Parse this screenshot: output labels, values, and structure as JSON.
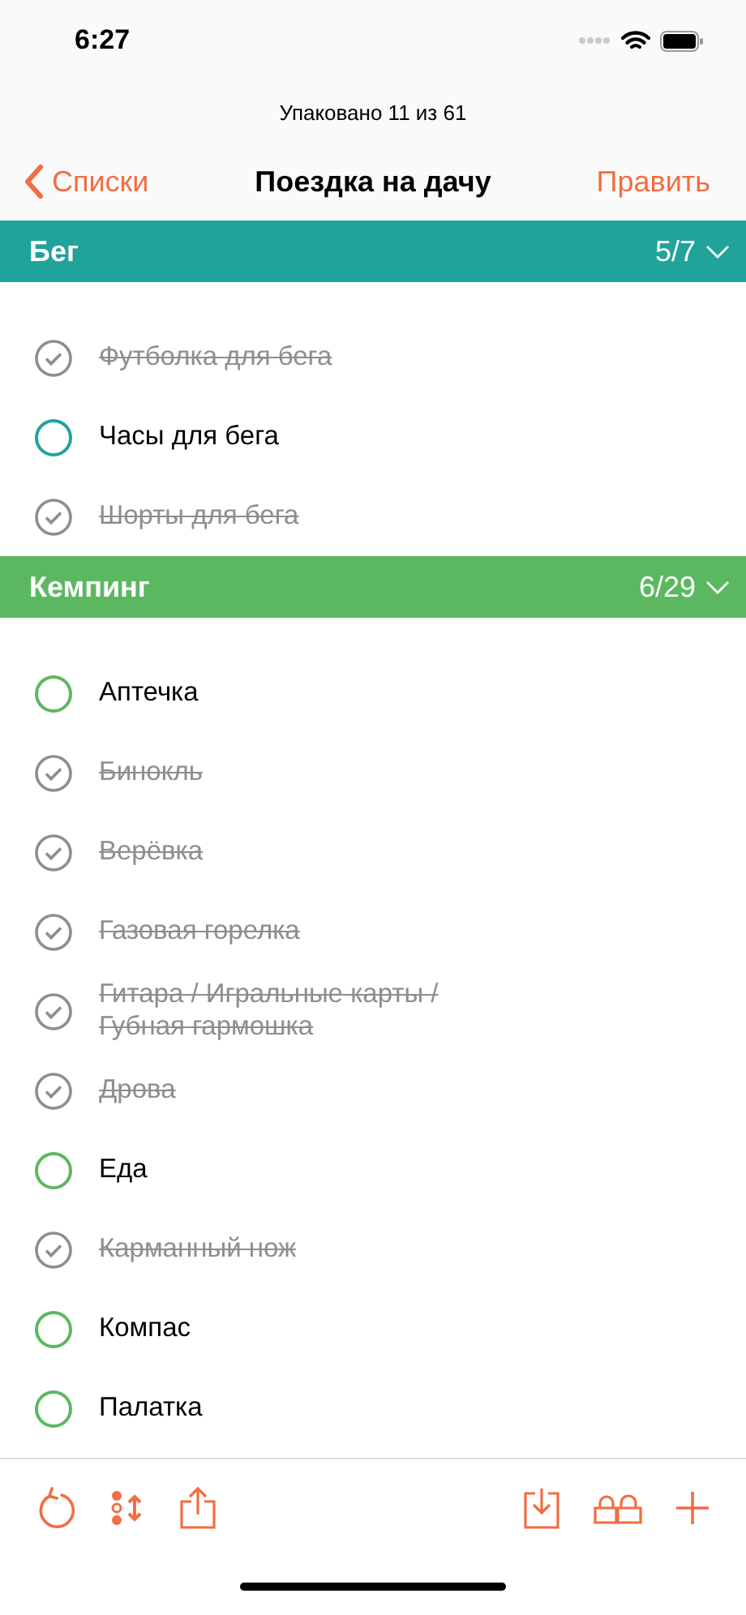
{
  "status_bar": {
    "time": "6:27"
  },
  "subtitle": "Упаковано 11 из 61",
  "nav": {
    "back": "Списки",
    "title": "Поездка на дачу",
    "edit": "Править"
  },
  "sections": [
    {
      "title": "Бег",
      "count": "5/7",
      "color": "#20a39a",
      "expanded": true,
      "items": [
        {
          "label": "Футболка для бега",
          "checked": true
        },
        {
          "label": "Часы для бега",
          "checked": false
        },
        {
          "label": "Шорты для бега",
          "checked": true
        }
      ]
    },
    {
      "title": "Кемпинг",
      "count": "6/29",
      "color": "#5cb860",
      "expanded": true,
      "items": [
        {
          "label": "Аптечка",
          "checked": false
        },
        {
          "label": "Бинокль",
          "checked": true
        },
        {
          "label": "Верёвка",
          "checked": true
        },
        {
          "label": "Газовая горелка",
          "checked": true
        },
        {
          "label": "Гитара / Игральные карты / Губная гармошка",
          "checked": true
        },
        {
          "label": "Дрова",
          "checked": true
        },
        {
          "label": "Еда",
          "checked": false
        },
        {
          "label": "Карманный нож",
          "checked": true
        },
        {
          "label": "Компас",
          "checked": false
        },
        {
          "label": "Палатка",
          "checked": false
        }
      ]
    }
  ]
}
